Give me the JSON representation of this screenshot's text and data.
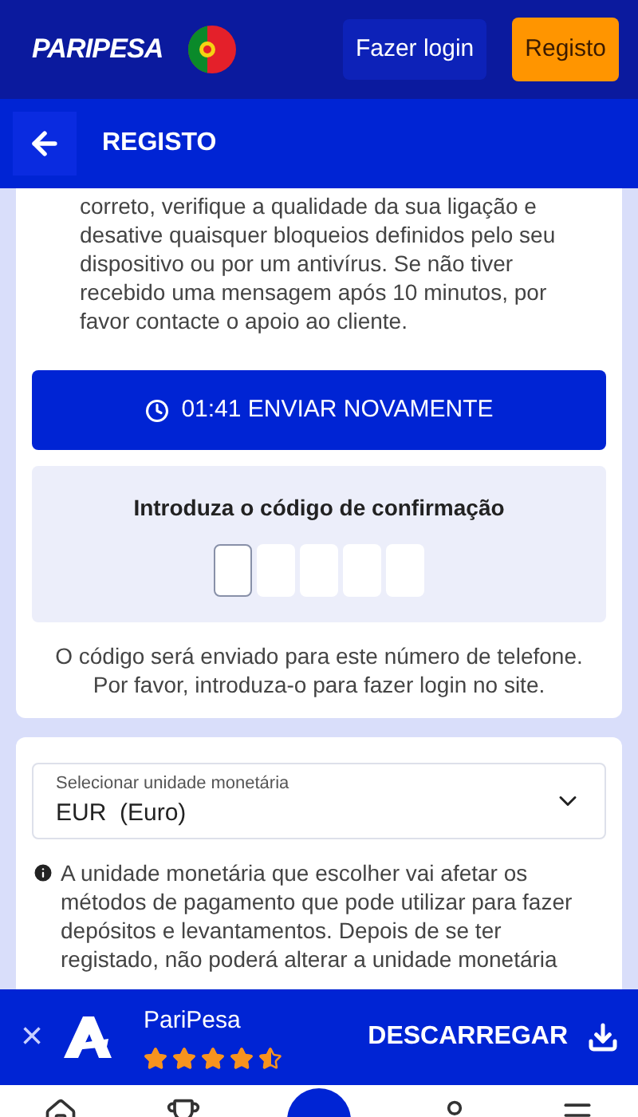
{
  "header": {
    "logo": "PARIPESA",
    "login_button": "Fazer login",
    "register_button": "Registo"
  },
  "page_bar": {
    "title": "REGISTO"
  },
  "sms_card": {
    "paragraph_lines": [
      "correto, verifique a qualidade da sua ligação e",
      "desative quaisquer bloqueios definidos pelo seu",
      "dispositivo ou por um antivírus. Se não tiver",
      "recebido uma mensagem após 10 minutos, por",
      "favor contacte o apoio ao cliente."
    ],
    "resend_button": "01:41 ENVIAR NOVAMENTE",
    "code_title": "Introduza o código de confirmação",
    "code_cells": [
      {
        "focused": true
      },
      {
        "focused": false
      },
      {
        "focused": false
      },
      {
        "focused": false
      },
      {
        "focused": false
      }
    ],
    "note": "O código será enviado para este número de telefone. Por favor, introduza-o para fazer login no site."
  },
  "currency_card": {
    "select_label": "Selecionar unidade monetária",
    "select_value": "EUR  (Euro)",
    "info_lines": [
      "A unidade monetária que escolher vai afetar os",
      "métodos de pagamento que pode utilizar para fazer",
      "depósitos e levantamentos. Depois de se ter",
      "registado, não poderá alterar a unidade monetária"
    ]
  },
  "app_banner": {
    "close": "×",
    "app_name": "PariPesa",
    "stars": 4.5,
    "download_button": "DESCARREGAR"
  }
}
